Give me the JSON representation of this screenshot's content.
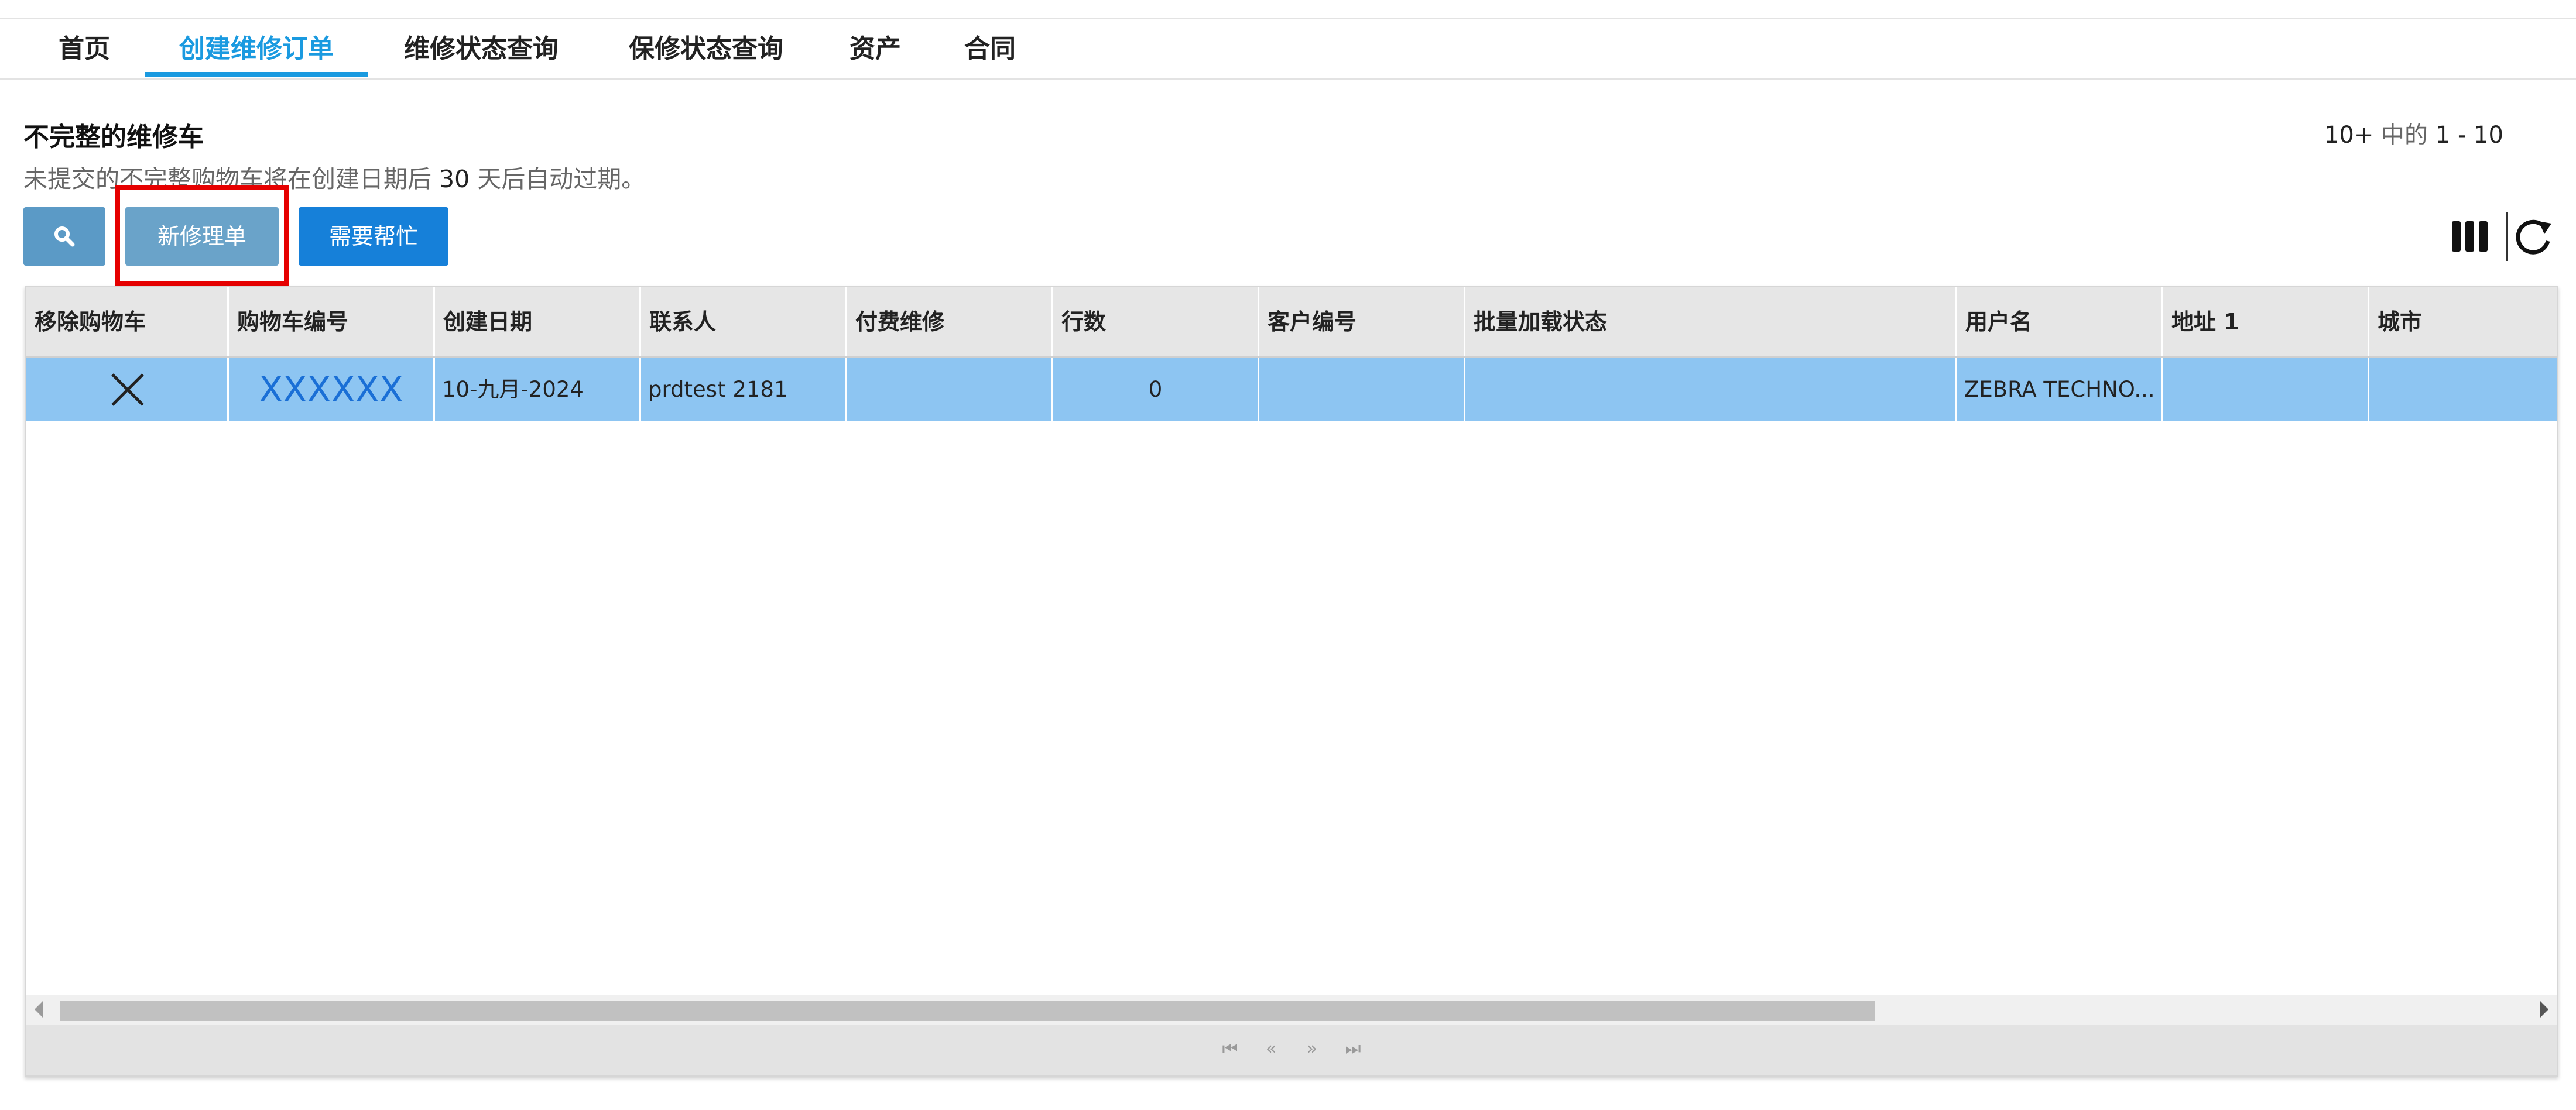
{
  "nav": {
    "items": [
      {
        "label": "首页",
        "active": false
      },
      {
        "label": "创建维修订单",
        "active": true
      },
      {
        "label": "维修状态查询",
        "active": false
      },
      {
        "label": "保修状态查询",
        "active": false
      },
      {
        "label": "资产",
        "active": false
      },
      {
        "label": "合同",
        "active": false
      }
    ]
  },
  "section": {
    "title": "不完整的维修车",
    "subtitle_before": "未提交的不完整购物车将在创建日期后 ",
    "subtitle_days": "30",
    "subtitle_after": " 天后自动过期。"
  },
  "pager_top": {
    "total": "10+",
    "word": " 中的 ",
    "range": "1 - 10"
  },
  "toolbar": {
    "search_icon": "search-icon",
    "new_label": "新修理单",
    "help_label": "需要帮忙",
    "columns_icon": "columns-icon",
    "refresh_icon": "refresh-icon"
  },
  "colors": {
    "accent": "#1a9ae0",
    "row_selected": "#8dc5f2",
    "highlight": "#e60000",
    "help_button": "#1680d9"
  },
  "table": {
    "headers": [
      "移除购物车",
      "购物车编号",
      "创建日期",
      "联系人",
      "付费维修",
      "行数",
      "客户编号",
      "批量加载状态",
      "用户名",
      "地址 1",
      "城市"
    ],
    "rows": [
      {
        "remove": "✕",
        "cart_id": "XXXXXX",
        "created": "10-九月-2024",
        "contact": "prdtest 2181",
        "paid_repair": "",
        "lines": "0",
        "customer_no": "",
        "bulk_status": "",
        "username": "ZEBRA TECHNO...",
        "address1": "",
        "city": ""
      }
    ]
  },
  "pagination": {
    "first": "⏮",
    "prev": "«",
    "next": "»",
    "last": "⏭"
  }
}
